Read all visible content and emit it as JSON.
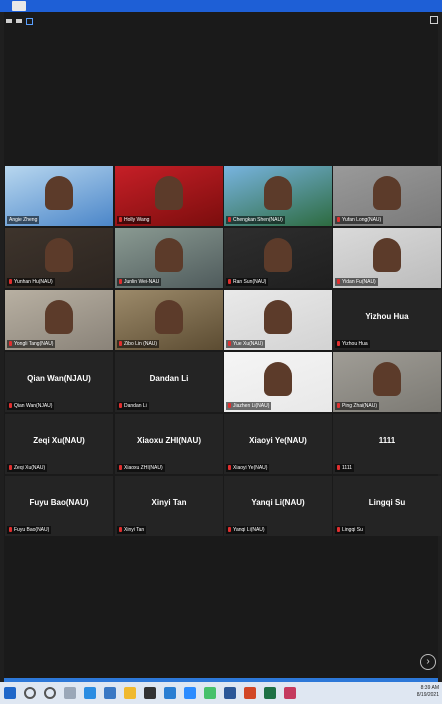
{
  "taskbar": {
    "time": "8:39 AM",
    "date": "8/19/2021"
  },
  "tiles": [
    {
      "name": "Angie Zheng",
      "center": "",
      "video": true,
      "muted": false
    },
    {
      "name": "Holly Wang",
      "center": "",
      "video": true,
      "muted": true
    },
    {
      "name": "Chengkan Shen(NAU)",
      "center": "",
      "video": true,
      "muted": true
    },
    {
      "name": "Yufan Long(NAU)",
      "center": "",
      "video": true,
      "muted": true
    },
    {
      "name": "Yunhan Hu(NAU)",
      "center": "",
      "video": true,
      "muted": true
    },
    {
      "name": "Junlin Wei-NAU",
      "center": "",
      "video": true,
      "muted": true
    },
    {
      "name": "Ran Sun(NAU)",
      "center": "",
      "video": true,
      "muted": true
    },
    {
      "name": "Yidan Fu(NAU)",
      "center": "",
      "video": true,
      "muted": true
    },
    {
      "name": "Yongli Tang(NAU)",
      "center": "",
      "video": true,
      "muted": true
    },
    {
      "name": "Zibo Lin (NAU)",
      "center": "",
      "video": true,
      "muted": true
    },
    {
      "name": "Yue Xu(NAU)",
      "center": "",
      "video": true,
      "muted": true
    },
    {
      "name": "Yizhou Hua",
      "center": "Yizhou Hua",
      "video": false,
      "muted": true
    },
    {
      "name": "Qian Wan(NJAU)",
      "center": "Qian Wan(NJAU)",
      "video": false,
      "muted": true
    },
    {
      "name": "Dandan Li",
      "center": "Dandan Li",
      "video": false,
      "muted": true
    },
    {
      "name": "Jiazhen Li(NAU)",
      "center": "",
      "video": true,
      "muted": true
    },
    {
      "name": "Ping Zhai(NAU)",
      "center": "",
      "video": true,
      "muted": true
    },
    {
      "name": "Zeqi Xu(NAU)",
      "center": "Zeqi Xu(NAU)",
      "video": false,
      "muted": true
    },
    {
      "name": "Xiaoxu ZHI(NAU)",
      "center": "Xiaoxu ZHI(NAU)",
      "video": false,
      "muted": true
    },
    {
      "name": "Xiaoyi Ye(NAU)",
      "center": "Xiaoyi Ye(NAU)",
      "video": false,
      "muted": true
    },
    {
      "name": "1111",
      "center": "1111",
      "video": false,
      "muted": true
    },
    {
      "name": "Fuyu Bao(NAU)",
      "center": "Fuyu Bao(NAU)",
      "video": false,
      "muted": true
    },
    {
      "name": "Xinyi Tan",
      "center": "Xinyi Tan",
      "video": false,
      "muted": true
    },
    {
      "name": "Yanqi Li(NAU)",
      "center": "Yanqi Li(NAU)",
      "video": false,
      "muted": true
    },
    {
      "name": "Lingqi Su",
      "center": "Lingqi Su",
      "video": false,
      "muted": true
    }
  ],
  "colors": {
    "accent": "#8ed14a",
    "muted_mic": "#e02f2f",
    "tile_bg": "#242424"
  }
}
